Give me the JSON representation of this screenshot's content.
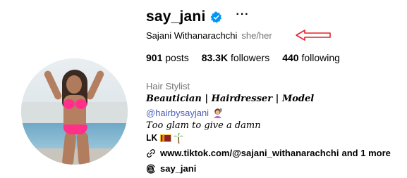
{
  "profile": {
    "username": "say_jani",
    "full_name": "Sajani Withanarachchi",
    "pronouns": "she/her",
    "category": "Hair Stylist"
  },
  "stats": {
    "posts_count": "901",
    "posts_label": "posts",
    "followers_count": "83.3K",
    "followers_label": "followers",
    "following_count": "440",
    "following_label": "following"
  },
  "bio": {
    "title": "𝑩𝒆𝒂𝒖𝒕𝒊𝒄𝒊𝒂𝒏 | 𝑯𝒂𝒊𝒓𝒅𝒓𝒆𝒔𝒔𝒆𝒓 | 𝑴𝒐𝒅𝒆𝒍",
    "handle": "@hairbysayjani",
    "tagline": "𝑇𝑜𝑜 𝑔𝑙𝑎𝑚 𝑡𝑜 𝑔𝑖𝑣𝑒 𝑎 𝑑𝑎𝑚𝑛",
    "country": "𝐋𝐊"
  },
  "links": {
    "url": "www.tiktok.com/@sajani_withanarachchi",
    "more": "and 1 more"
  },
  "threads": {
    "name": "say_jani"
  },
  "icons": {
    "verified": "verified-badge-icon",
    "more": "more-options-icon",
    "link": "link-icon",
    "threads": "threads-icon",
    "arrow": "red-arrow-annotation"
  },
  "colors": {
    "verified_blue": "#0095f6",
    "link_blue": "#4c5fbf",
    "annotation_red": "#e5202a",
    "secondary_text": "#737373"
  }
}
